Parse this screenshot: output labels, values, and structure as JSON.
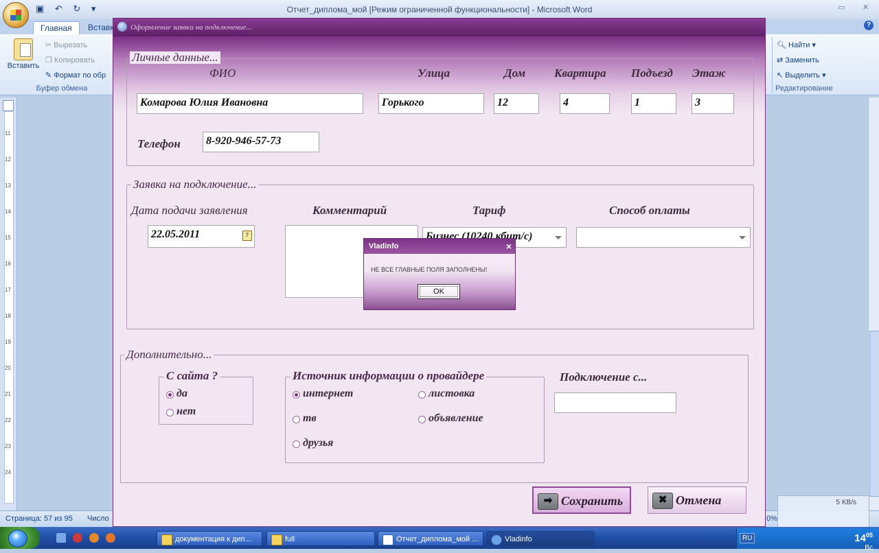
{
  "word": {
    "title": "Отчет_диплома_мой [Режим ограниченной функциональности] - Microsoft Word",
    "tabs": [
      "Главная",
      "Вставка"
    ],
    "clipboard": {
      "paste": "Вставить",
      "cut": "Вырезать",
      "copy": "Копировать",
      "format": "Формат по обр",
      "group": "Буфер обмена"
    },
    "editing": {
      "find": "Найти",
      "replace": "Заменить",
      "select": "Выделить",
      "group": "Редактирование"
    },
    "status": {
      "page": "Страница: 57 из 95",
      "words": "Число",
      "zoom": "0%"
    },
    "netmeter": "5 KB/s",
    "ruler_numbers": [
      "11",
      "12",
      "13",
      "14",
      "15",
      "16",
      "17",
      "18",
      "19",
      "20",
      "21",
      "22",
      "23",
      "24"
    ]
  },
  "taskbar": {
    "buttons": [
      "документация к дип...",
      "full",
      "Отчет_диплома_мой ...",
      "Vladinfo"
    ],
    "lang": "RU",
    "time": "14",
    "time_min": "05",
    "day": "Вс"
  },
  "form": {
    "title": "Оформление заявки на подключение...",
    "personal": {
      "legend": "Личные данные...",
      "labels": {
        "fio": "ФИО",
        "street": "Улица",
        "house": "Дом",
        "flat": "Квартира",
        "entrance": "Подъезд",
        "floor": "Этаж",
        "phone": "Телефон"
      },
      "values": {
        "fio": "Комарова Юлия Ивановна",
        "street": "Горького",
        "house": "12",
        "flat": "4",
        "entrance": "1",
        "floor": "3",
        "phone": "8-920-946-57-73"
      }
    },
    "request": {
      "legend": "Заявка на подключение...",
      "labels": {
        "date": "Дата подачи заявления",
        "comment": "Комментарий",
        "tariff": "Тариф",
        "payment": "Способ оплаты"
      },
      "values": {
        "date": "22.05.2011",
        "comment": "",
        "tariff": "Бизнес (10240 кбит/с)",
        "payment": ""
      },
      "calendar_glyph": "7"
    },
    "extra": {
      "legend": "Дополнительно...",
      "site": {
        "legend": "С сайта ?",
        "options": [
          "да",
          "нет"
        ],
        "selected": "да"
      },
      "source": {
        "legend": "Источник информации о провайдере",
        "options": [
          "интернет",
          "листовка",
          "тв",
          "объявление",
          "друзья"
        ],
        "selected": "интернет"
      },
      "connect_label": "Подключение с...",
      "connect_value": ""
    },
    "buttons": {
      "save": "Сохранить",
      "cancel": "Отмена"
    }
  },
  "message": {
    "title": "Vladinfo",
    "text": "НЕ ВСЕ ГЛАВНЫЕ ПОЛЯ ЗАПОЛНЕНЫ!",
    "ok": "OK"
  },
  "colors": {
    "accent": "#7d3386",
    "dialog_bg": "#f1e6f1"
  }
}
